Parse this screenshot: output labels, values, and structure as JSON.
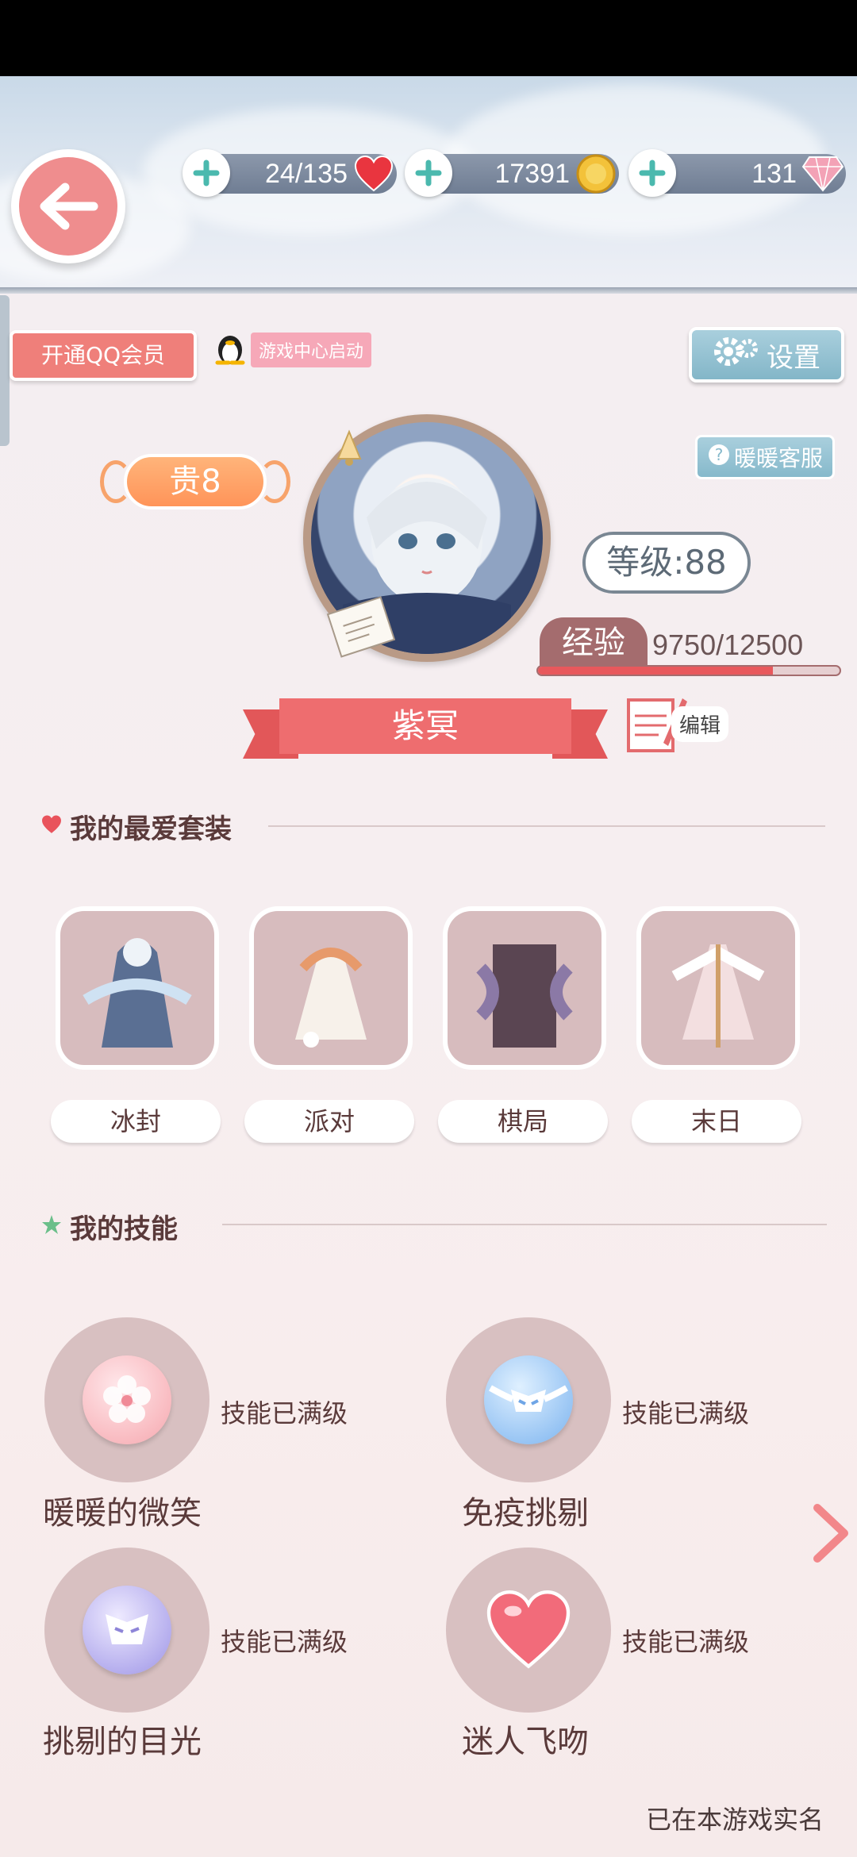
{
  "resources": {
    "stamina": "24/135",
    "coins": "17391",
    "diamonds": "131"
  },
  "top_buttons": {
    "qq_vip": "开通QQ会员",
    "game_center": "游戏中心启动",
    "settings": "设置",
    "service": "暖暖客服"
  },
  "profile": {
    "vip_level": "贵8",
    "level": "等级:88",
    "exp_label": "经验",
    "exp_value": "9750/12500",
    "exp_fraction": 0.78,
    "name": "紫冥",
    "edit_label": "编辑"
  },
  "outfits_section": {
    "title": "我的最爱套装",
    "items": [
      {
        "label": "冰封"
      },
      {
        "label": "派对"
      },
      {
        "label": "棋局"
      },
      {
        "label": "末日"
      }
    ]
  },
  "skills_section": {
    "title": "我的技能",
    "items": [
      {
        "name": "暖暖的微笑",
        "status": "技能已满级"
      },
      {
        "name": "免疫挑剔",
        "status": "技能已满级"
      },
      {
        "name": "挑剔的目光",
        "status": "技能已满级"
      },
      {
        "name": "迷人飞吻",
        "status": "技能已满级"
      }
    ]
  },
  "footer": {
    "realname": "已在本游戏实名"
  },
  "colors": {
    "accent_pink": "#ee6d6f",
    "back_button": "#ef8d8e",
    "settings_blue": "#83b6c8"
  }
}
